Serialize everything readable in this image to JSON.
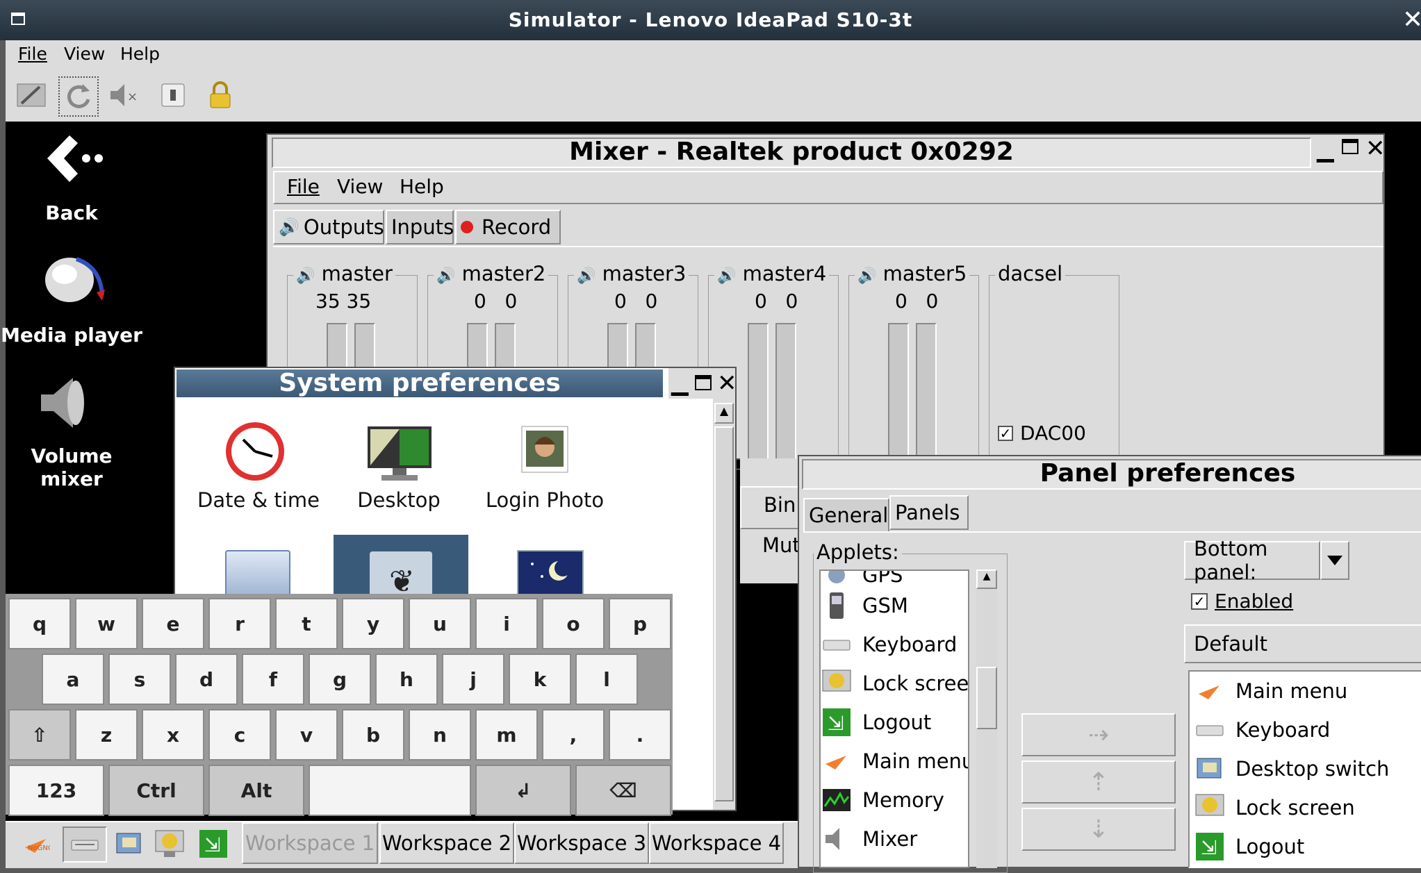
{
  "app": {
    "title": "Simulator - Lenovo IdeaPad S10-3t"
  },
  "menubar": {
    "file": "File",
    "view": "View",
    "help": "Help"
  },
  "desktop": {
    "back": "Back",
    "media_player": "Media player",
    "volume_mixer": "Volume mixer"
  },
  "mixer": {
    "title": "Mixer - Realtek product 0x0292",
    "menu": {
      "file": "File",
      "view": "View",
      "help": "Help"
    },
    "tabs": {
      "outputs": "Outputs",
      "inputs": "Inputs",
      "record": "Record"
    },
    "channels": [
      {
        "name": "master",
        "values": "35 35"
      },
      {
        "name": "master2",
        "values": "0   0"
      },
      {
        "name": "master3",
        "values": "0   0"
      },
      {
        "name": "master4",
        "values": "0   0"
      },
      {
        "name": "master5",
        "values": "0   0"
      },
      {
        "name": "dacsel",
        "values": ""
      }
    ],
    "dac_checkbox": "DAC00",
    "partial_bin": "Bin",
    "partial_mut": "Mut"
  },
  "sysprefs": {
    "title": "System preferences",
    "items": [
      "Date & time",
      "Desktop",
      "Login Photo"
    ]
  },
  "keyboard": {
    "row1": [
      "q",
      "w",
      "e",
      "r",
      "t",
      "y",
      "u",
      "i",
      "o",
      "p"
    ],
    "row2": [
      "a",
      "s",
      "d",
      "f",
      "g",
      "h",
      "j",
      "k",
      "l"
    ],
    "row3": [
      "⇧",
      "z",
      "x",
      "c",
      "v",
      "b",
      "n",
      "m",
      ",",
      "."
    ],
    "row4": {
      "num": "123",
      "ctrl": "Ctrl",
      "alt": "Alt",
      "space": "",
      "enter": "↲",
      "backspace": "⌫"
    }
  },
  "taskbar": {
    "workspaces": [
      "Workspace 1",
      "Workspace 2",
      "Workspace 3",
      "Workspace 4"
    ]
  },
  "panelprefs": {
    "title": "Panel preferences",
    "tabs": {
      "general": "General",
      "panels": "Panels"
    },
    "applets_label": "Applets:",
    "applets": [
      "GPS",
      "GSM",
      "Keyboard",
      "Lock screen",
      "Logout",
      "Main menu",
      "Memory",
      "Mixer"
    ],
    "panel_select": "Bottom panel:",
    "enabled": "Enabled",
    "default_label": "Default",
    "panel_items": [
      "Main menu",
      "Keyboard",
      "Desktop switch",
      "Lock screen",
      "Logout"
    ]
  }
}
